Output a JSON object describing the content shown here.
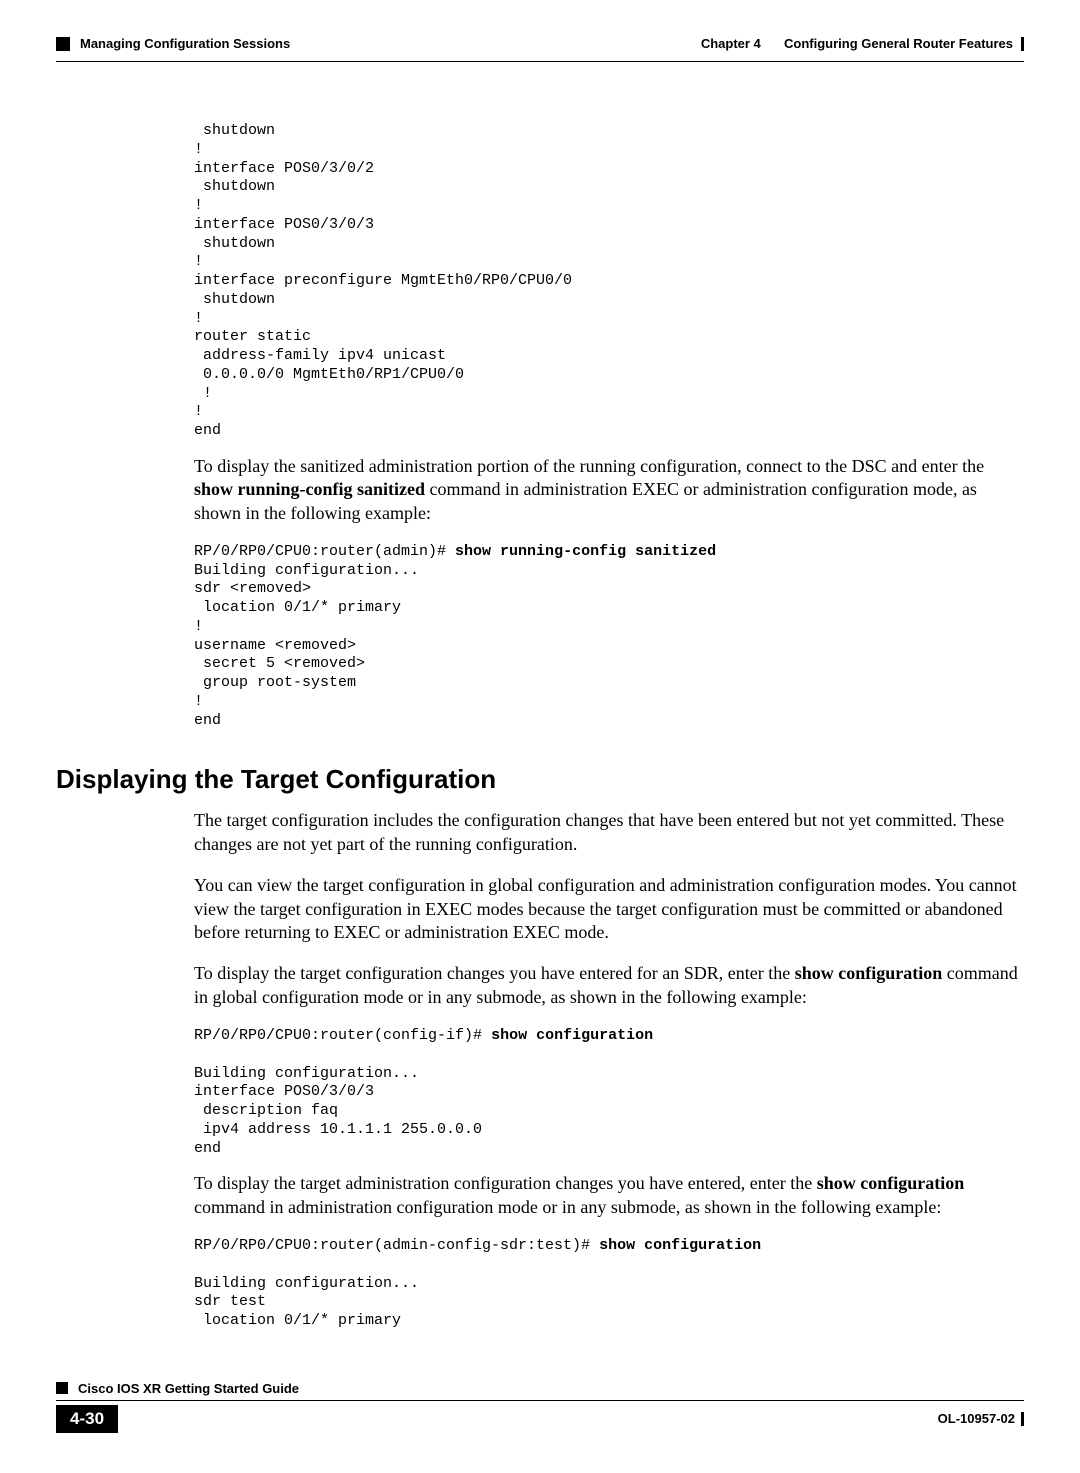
{
  "header": {
    "chapter": "Chapter 4",
    "chapter_title": "Configuring General Router Features",
    "section": "Managing Configuration Sessions"
  },
  "code1": " shutdown\n!\ninterface POS0/3/0/2\n shutdown\n!\ninterface POS0/3/0/3\n shutdown\n!\ninterface preconfigure MgmtEth0/RP0/CPU0/0\n shutdown\n!\nrouter static\n address-family ipv4 unicast\n 0.0.0.0/0 MgmtEth0/RP1/CPU0/0\n !\n!\nend",
  "para1_a": "To display the sanitized administration portion of the running configuration, connect to the DSC and enter the ",
  "para1_bold": "show running-config sanitized",
  "para1_b": " command in administration EXEC or administration configuration mode, as shown in the following example:",
  "code2_prefix": "RP/0/RP0/CPU0:router(admin)# ",
  "code2_cmd": "show running-config sanitized",
  "code2_body": "Building configuration...\nsdr <removed>\n location 0/1/* primary\n!\nusername <removed>\n secret 5 <removed>\n group root-system\n!\nend",
  "h2": "Displaying the Target Configuration",
  "para2": "The target configuration includes the configuration changes that have been entered but not yet committed. These changes are not yet part of the running configuration.",
  "para3": "You can view the target configuration in global configuration and administration configuration modes. You cannot view the target configuration in EXEC modes because the target configuration must be committed or abandoned before returning to EXEC or administration EXEC mode.",
  "para4_a": "To display the target configuration changes you have entered for an SDR, enter the ",
  "para4_bold": "show configuration",
  "para4_b": " command in global configuration mode or in any submode, as shown in the following example:",
  "code3_prefix": "RP/0/RP0/CPU0:router(config-if)# ",
  "code3_cmd": "show configuration",
  "code3_body": "\nBuilding configuration...\ninterface POS0/3/0/3\n description faq\n ipv4 address 10.1.1.1 255.0.0.0\nend",
  "para5_a": "To display the target administration configuration changes you have entered, enter the ",
  "para5_bold": "show configuration",
  "para5_b": " command in administration configuration mode or in any submode, as shown in the following example:",
  "code4_prefix": "RP/0/RP0/CPU0:router(admin-config-sdr:test)# ",
  "code4_cmd": "show configuration",
  "code4_body": "\nBuilding configuration...\nsdr test\n location 0/1/* primary",
  "footer": {
    "guide": "Cisco IOS XR Getting Started Guide",
    "page": "4-30",
    "docnum": "OL-10957-02"
  }
}
